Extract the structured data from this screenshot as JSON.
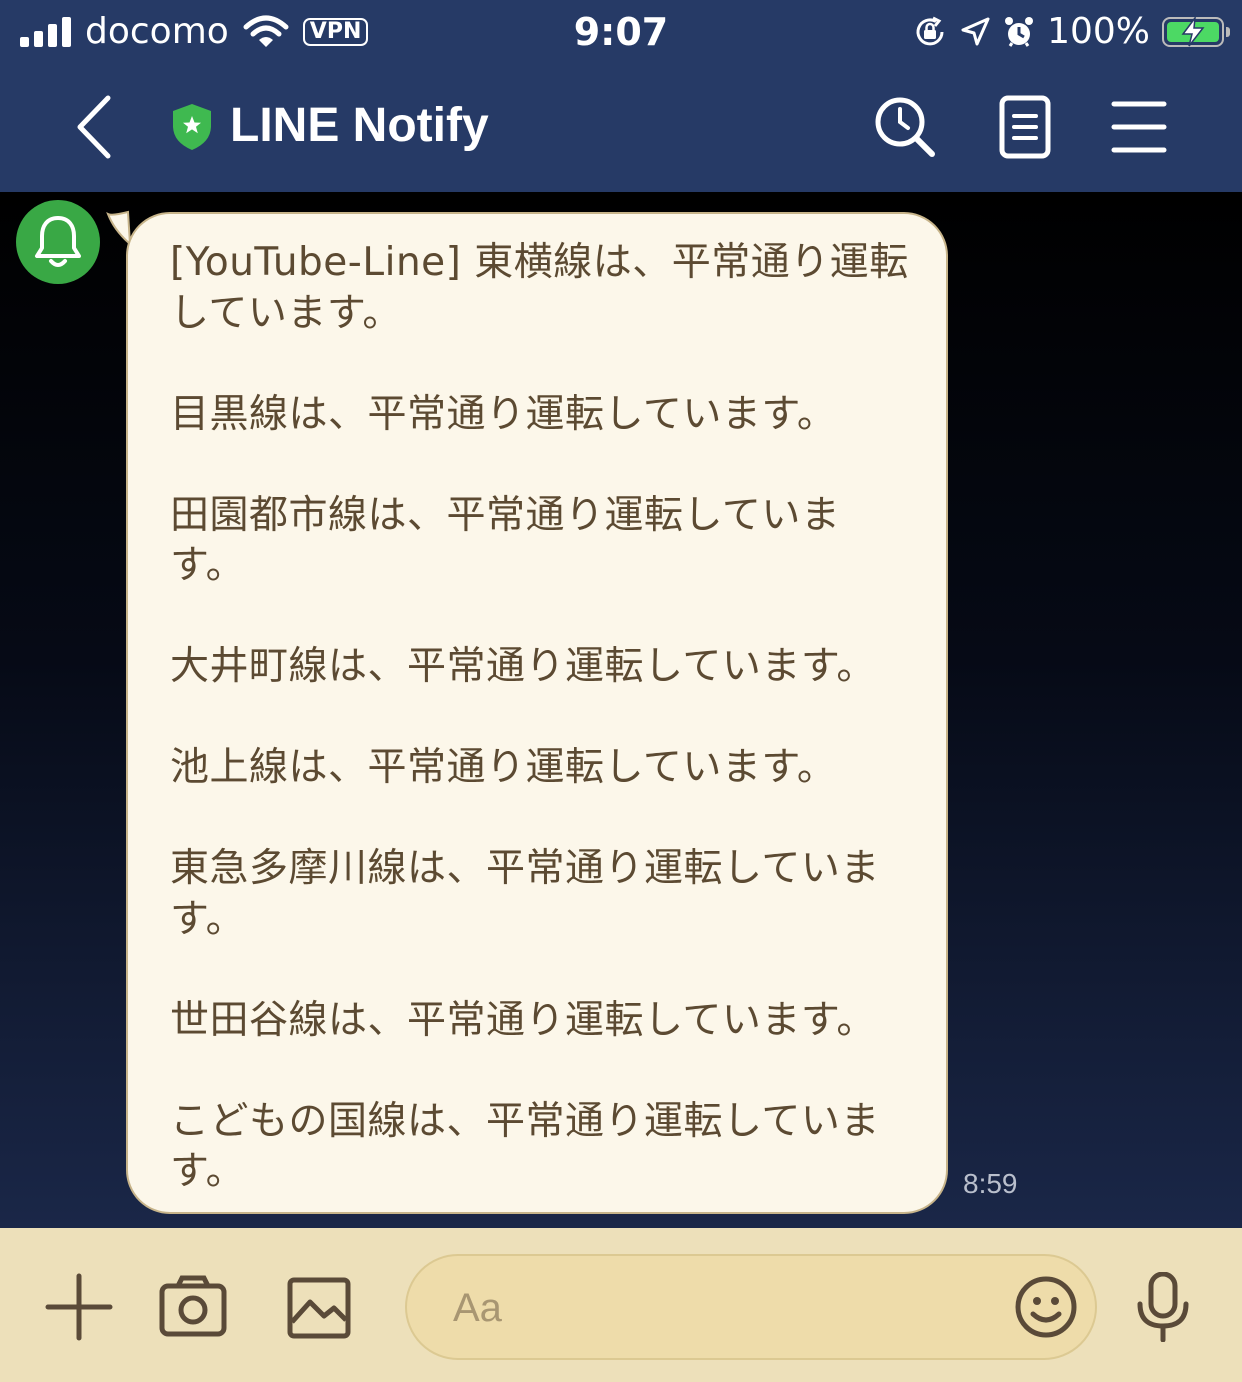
{
  "status_bar": {
    "carrier": "docomo",
    "vpn_label": "VPN",
    "time": "9:07",
    "battery_percent": "100%",
    "battery_level": 1.0,
    "battery_charging": true
  },
  "header": {
    "title": "LINE Notify",
    "icons": [
      "back-icon",
      "shield-icon",
      "search-icon",
      "notes-icon",
      "menu-icon"
    ]
  },
  "chat": {
    "sender_avatar_icon": "bell-icon",
    "message": {
      "text": "[YouTube-Line] 東横線は、平常通り運転\nしています。\n\n目黒線は、平常通り運転しています。\n\n田園都市線は、平常通り運転していま\nす。\n\n大井町線は、平常通り運転しています。\n\n池上線は、平常通り運転しています。\n\n東急多摩川線は、平常通り運転していま\nす。\n\n世田谷線は、平常通り運転しています。\n\nこどもの国線は、平常通り運転していま\nす。",
      "time": "8:59"
    }
  },
  "input_bar": {
    "placeholder": "Aa",
    "icons": [
      "plus-icon",
      "camera-icon",
      "image-icon",
      "emoji-icon",
      "mic-icon"
    ]
  },
  "colors": {
    "header_bg": "#263a66",
    "bubble_bg": "#fcf7ea",
    "bubble_text": "#5c4a32",
    "input_bar_bg": "#ede0ba",
    "avatar_bg": "#39a845",
    "battery_fill": "#4cd964"
  }
}
